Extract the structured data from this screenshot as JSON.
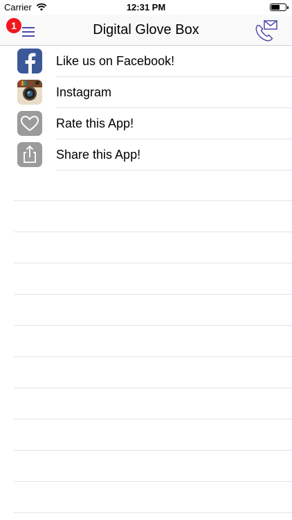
{
  "status_bar": {
    "carrier": "Carrier",
    "time": "12:31 PM"
  },
  "nav": {
    "title": "Digital Glove Box",
    "badge_count": "1",
    "accent": "#4a4aa8"
  },
  "menu_items": [
    {
      "label": "Like us on Facebook!",
      "icon": "facebook-icon"
    },
    {
      "label": "Instagram",
      "icon": "instagram-icon"
    },
    {
      "label": "Rate this App!",
      "icon": "heart-icon"
    },
    {
      "label": "Share this App!",
      "icon": "share-icon"
    }
  ],
  "colors": {
    "badge": "#f2171e",
    "facebook": "#3b5998",
    "gray_icon": "#9b9b9b"
  }
}
